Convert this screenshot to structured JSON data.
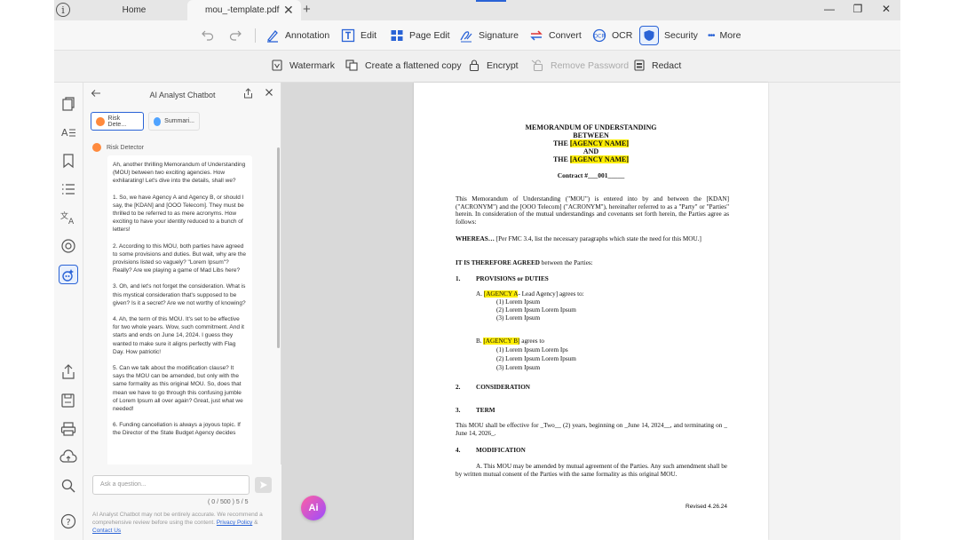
{
  "titlebar": {
    "info_glyph": "i",
    "tabs": [
      {
        "label": "Home"
      },
      {
        "label": "mou_-template.pdf"
      }
    ],
    "tab_close_glyph": "✕",
    "new_tab_glyph": "+",
    "window": {
      "minimize": "—",
      "restore": "❐",
      "close": "✕"
    }
  },
  "toolbar": {
    "items": [
      {
        "label": "Annotation",
        "icon": "pen-icon"
      },
      {
        "label": "Edit",
        "icon": "edit-text-icon"
      },
      {
        "label": "Page Edit",
        "icon": "grid-icon"
      },
      {
        "label": "Signature",
        "icon": "signature-icon"
      },
      {
        "label": "Convert",
        "icon": "convert-icon"
      },
      {
        "label": "OCR",
        "icon": "ocr-icon"
      },
      {
        "label": "Security",
        "icon": "shield-icon"
      },
      {
        "label": "More",
        "icon": "dots-icon"
      }
    ],
    "more_dots": "•••"
  },
  "security_toolbar": {
    "items": [
      {
        "label": "Watermark",
        "icon": "watermark-icon",
        "enabled": true
      },
      {
        "label": "Create a flattened copy",
        "icon": "flatten-icon",
        "enabled": true
      },
      {
        "label": "Encrypt",
        "icon": "lock-icon",
        "enabled": true
      },
      {
        "label": "Remove Password",
        "icon": "unlock-icon",
        "enabled": false
      },
      {
        "label": "Redact",
        "icon": "redact-icon",
        "enabled": true
      }
    ]
  },
  "chat": {
    "title": "AI Analyst Chatbot",
    "chips": [
      {
        "label": "Risk Dete..."
      },
      {
        "label": "Summari..."
      }
    ],
    "sender": "Risk Detector",
    "message": [
      "Ah, another thrilling Memorandum of Understanding (MOU) between two exciting agencies. How exhilarating! Let's dive into the details, shall we?",
      "1. So, we have Agency A and Agency B, or should I say, the [KDAN] and [OOO Telecom]. They must be thrilled to be referred to as mere acronyms. How exciting to have your identity reduced to a bunch of letters!",
      "2. According to this MOU, both parties have agreed to some provisions and duties. But wait, why are the provisions listed so vaguely? \"Lorem Ipsum\"? Really? Are we playing a game of Mad Libs here?",
      "3. Oh, and let's not forget the consideration. What is this mystical consideration that's supposed to be given? Is it a secret? Are we not worthy of knowing?",
      "4. Ah, the term of this MOU. It's set to be effective for two whole years. Wow, such commitment. And it starts and ends on June 14, 2024. I guess they wanted to make sure it aligns perfectly with Flag Day. How patriotic!",
      "5. Can we talk about the modification clause? It says the MOU can be amended, but only with the same formality as this original MOU. So, does that mean we have to go through this confusing jumble of Lorem Ipsum all over again? Great, just what we needed!",
      "6. Funding cancellation is always a joyous topic. If the Director of the State Budget Agency decides"
    ],
    "input_placeholder": "Ask a question...",
    "counter": "( 0 / 500 )    5 / 5",
    "disclaimer_text": "AI Analyst Chatbot may not be entirely accurate. We recommend a comprehensive review before using the content.",
    "privacy_link": "Privacy Policy",
    "amp": "&",
    "contact_link": "Contact Us"
  },
  "ai_fab": "Ai",
  "document": {
    "heading1": "MEMORANDUM OF UNDERSTANDING",
    "heading2": "BETWEEN",
    "the1": "THE",
    "agency_name1": "[AGENCY NAME]",
    "and": "AND",
    "the2": "THE",
    "agency_name2": "[AGENCY NAME]",
    "contract": "Contract #___001_____",
    "intro": "This Memorandum of Understanding (\"MOU\") is entered into by and between the [KDAN] (\"ACRONYM\") and the [OOO Telecom] (\"ACRONYM\"), hereinafter referred to as a \"Party\" or \"Parties\" herein. In consideration of the mutual understandings and covenants set forth herein, the Parties agree as follows:",
    "whereas_label": "WHEREAS…",
    "whereas_text": " [Per FMC 3.4, list the necessary paragraphs which state the need for this MOU.]",
    "agreed_bold": "IT IS THEREFORE AGREED",
    "agreed_rest": " between the Parties:",
    "s1_num": "1.",
    "s1_title": "PROVISIONS or DUTIES",
    "a_prefix": "A. ",
    "a_agency": "[AGENCY A",
    "a_rest": "- Lead Agency] agrees to:",
    "a_items": [
      "(1) Lorem Ipsum",
      "(2) Lorem Ipsum Lorem Ipsum",
      "(3) Lorem Ipsum"
    ],
    "b_prefix": "B. ",
    "b_agency": "[AGENCY B]",
    "b_rest": " agrees to",
    "b_items": [
      "(1) Lorem Ipsum Lorem Ips",
      "(2) Lorem Ipsum Lorem Ipsum",
      "(3) Lorem Ipsum"
    ],
    "s2_num": "2.",
    "s2_title": "CONSIDERATION",
    "s3_num": "3.",
    "s3_title": "TERM",
    "term_text": "This MOU shall be effective for _Two__ (2) years, beginning on _June 14, 2024__, and terminating on _ June 14, 2026_.",
    "s4_num": "4.",
    "s4_title": "MODIFICATION",
    "mod_text": "A. This MOU may be amended by mutual agreement of the Parties. Any such amendment shall be by written mutual consent of the Parties with the same formality as this original MOU.",
    "revised": "Revised 4.26.24"
  },
  "colors": {
    "accent": "#2a63d6",
    "highlight": "#ffee00",
    "fab_from": "#ff5fa2",
    "fab_to": "#9b4dff"
  }
}
